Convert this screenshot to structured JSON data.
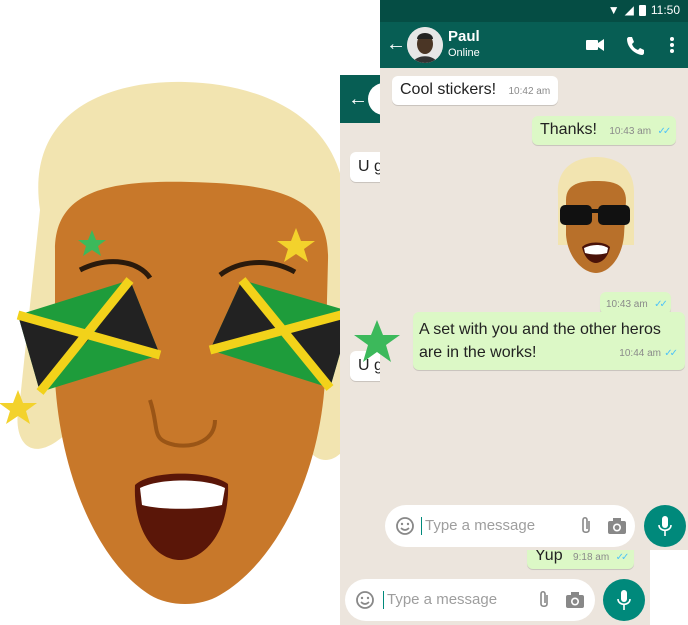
{
  "status_bar": {
    "time": "11:50"
  },
  "contact": {
    "name": "Paul",
    "status": "Online"
  },
  "messages": [
    {
      "text": "Cool stickers!",
      "time": "10:42 am",
      "direction": "in"
    },
    {
      "text": "Thanks!",
      "time": "10:43 am",
      "direction": "out"
    },
    {
      "type": "sticker",
      "time": "10:43 am",
      "direction": "out"
    },
    {
      "text": "A set with you and the other heros are in the works!",
      "time": "10:44 am",
      "direction": "out"
    }
  ],
  "input": {
    "placeholder": "Type a message"
  },
  "back_phone": {
    "partial_message_1": "U g",
    "partial_message_2": "U g",
    "sent_message": {
      "text": "Yup",
      "time": "9:18 am"
    },
    "placeholder": "Type a message"
  },
  "colors": {
    "header": "#075e54",
    "status_bar": "#054d44",
    "outgoing_bubble": "#dcf8c6",
    "send_button": "#00897b",
    "read_ticks": "#4fc3f7"
  }
}
